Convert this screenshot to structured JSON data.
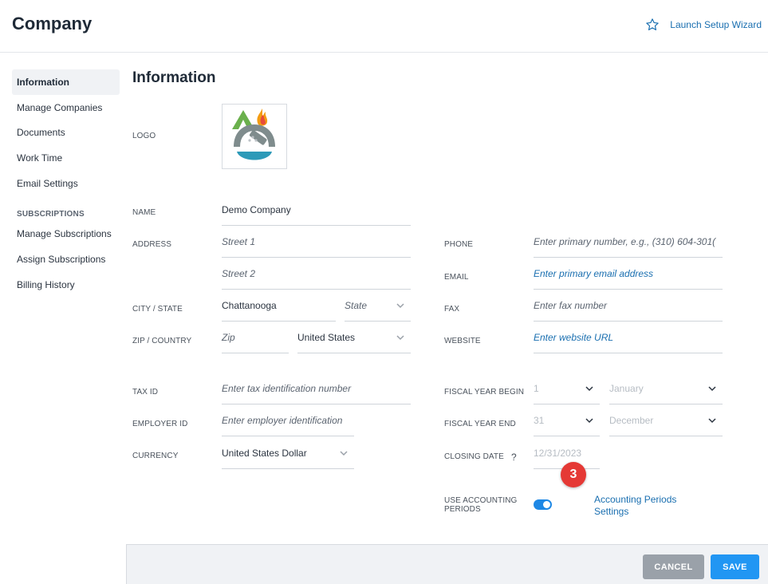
{
  "header": {
    "title": "Company",
    "wizard_label": "Launch Setup Wizard"
  },
  "sidebar": {
    "items": [
      {
        "label": "Information"
      },
      {
        "label": "Manage Companies"
      },
      {
        "label": "Documents"
      },
      {
        "label": "Work Time"
      },
      {
        "label": "Email Settings"
      }
    ],
    "section_label": "SUBSCRIPTIONS",
    "sub_items": [
      {
        "label": "Manage Subscriptions"
      },
      {
        "label": "Assign Subscriptions"
      },
      {
        "label": "Billing History"
      }
    ]
  },
  "main": {
    "section_title": "Information",
    "labels": {
      "logo": "LOGO",
      "name": "NAME",
      "address": "ADDRESS",
      "city_state": "CITY / STATE",
      "zip_country": "ZIP / COUNTRY",
      "tax_id": "TAX ID",
      "employer_id": "EMPLOYER ID",
      "currency": "CURRENCY",
      "phone": "PHONE",
      "email": "EMAIL",
      "fax": "FAX",
      "website": "WEBSITE",
      "fiscal_begin": "FISCAL YEAR BEGIN",
      "fiscal_end": "FISCAL YEAR END",
      "closing_date": "CLOSING DATE",
      "use_accounting_periods": "USE ACCOUNTING PERIODS"
    },
    "fields": {
      "name": "Demo Company",
      "street1_placeholder": "Street 1",
      "street2_placeholder": "Street 2",
      "city": "Chattanooga",
      "state_placeholder": "State",
      "zip_placeholder": "Zip",
      "country": "United States",
      "tax_id_placeholder": "Enter tax identification number",
      "employer_id_placeholder": "Enter employer identification",
      "currency": "United States Dollar",
      "phone_placeholder": "Enter primary number, e.g., (310) 604-301(",
      "email_placeholder": "Enter primary email address",
      "fax_placeholder": "Enter fax number",
      "website_placeholder": "Enter website URL",
      "fiscal_begin_day": "1",
      "fiscal_begin_month": "January",
      "fiscal_end_day": "31",
      "fiscal_end_month": "December",
      "closing_date": "12/31/2023"
    },
    "help_mark": "?",
    "step_badge": "3",
    "accounting_periods_enabled": true,
    "accounting_periods_link": "Accounting Periods Settings"
  },
  "footer": {
    "cancel_label": "CANCEL",
    "save_label": "SAVE"
  },
  "colors": {
    "accent": "#2196f3",
    "link": "#1a6fb0",
    "badge": "#e53935",
    "cancel": "#9aa1a9"
  }
}
